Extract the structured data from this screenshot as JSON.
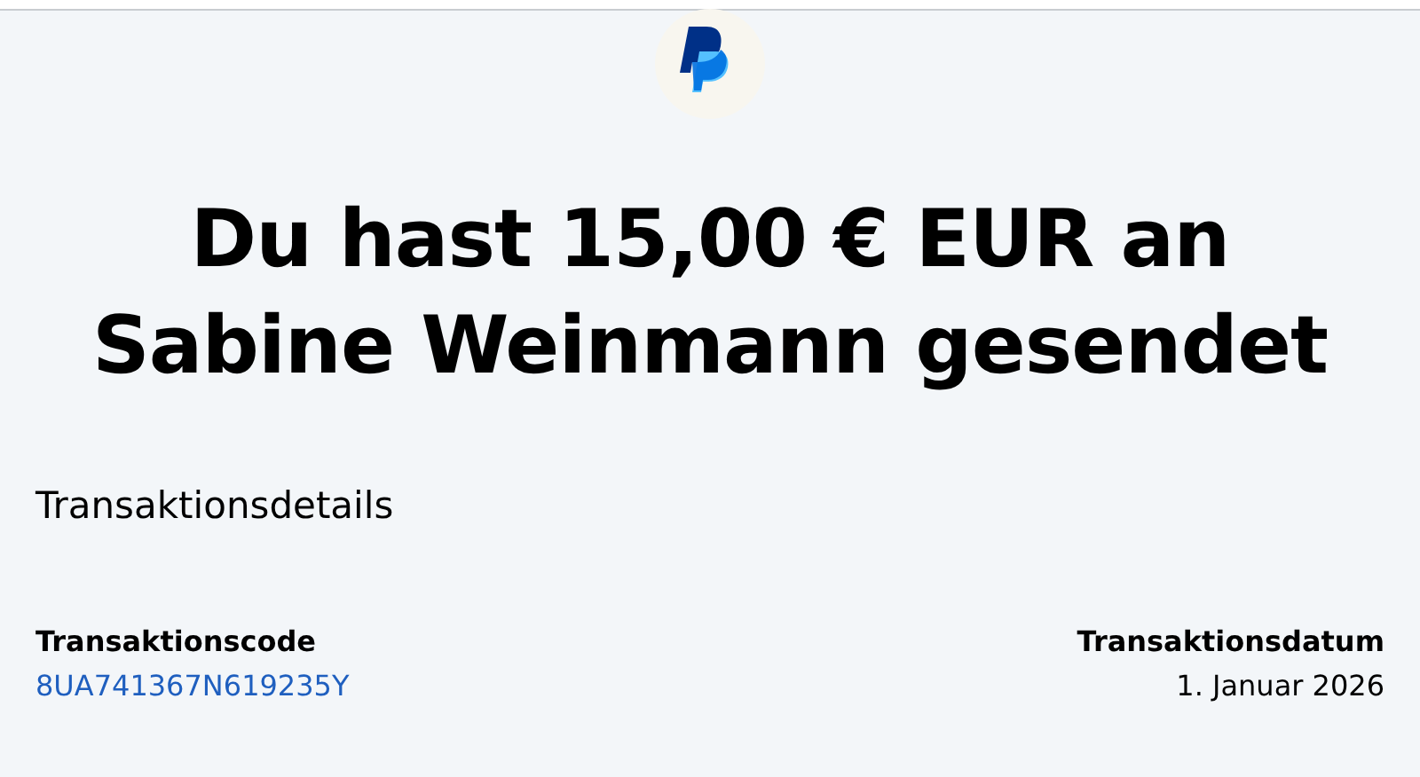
{
  "heading": "Du hast 15,00 € EUR an Sabine Weinmann gesendet",
  "section_title": "Transaktionsdetails",
  "details": [
    {
      "label": "Transaktionscode",
      "value": "8UA741367N619235Y",
      "kind": "link"
    },
    {
      "label": "Transaktionsdatum",
      "value": "1. Januar 2026",
      "kind": "text"
    }
  ]
}
